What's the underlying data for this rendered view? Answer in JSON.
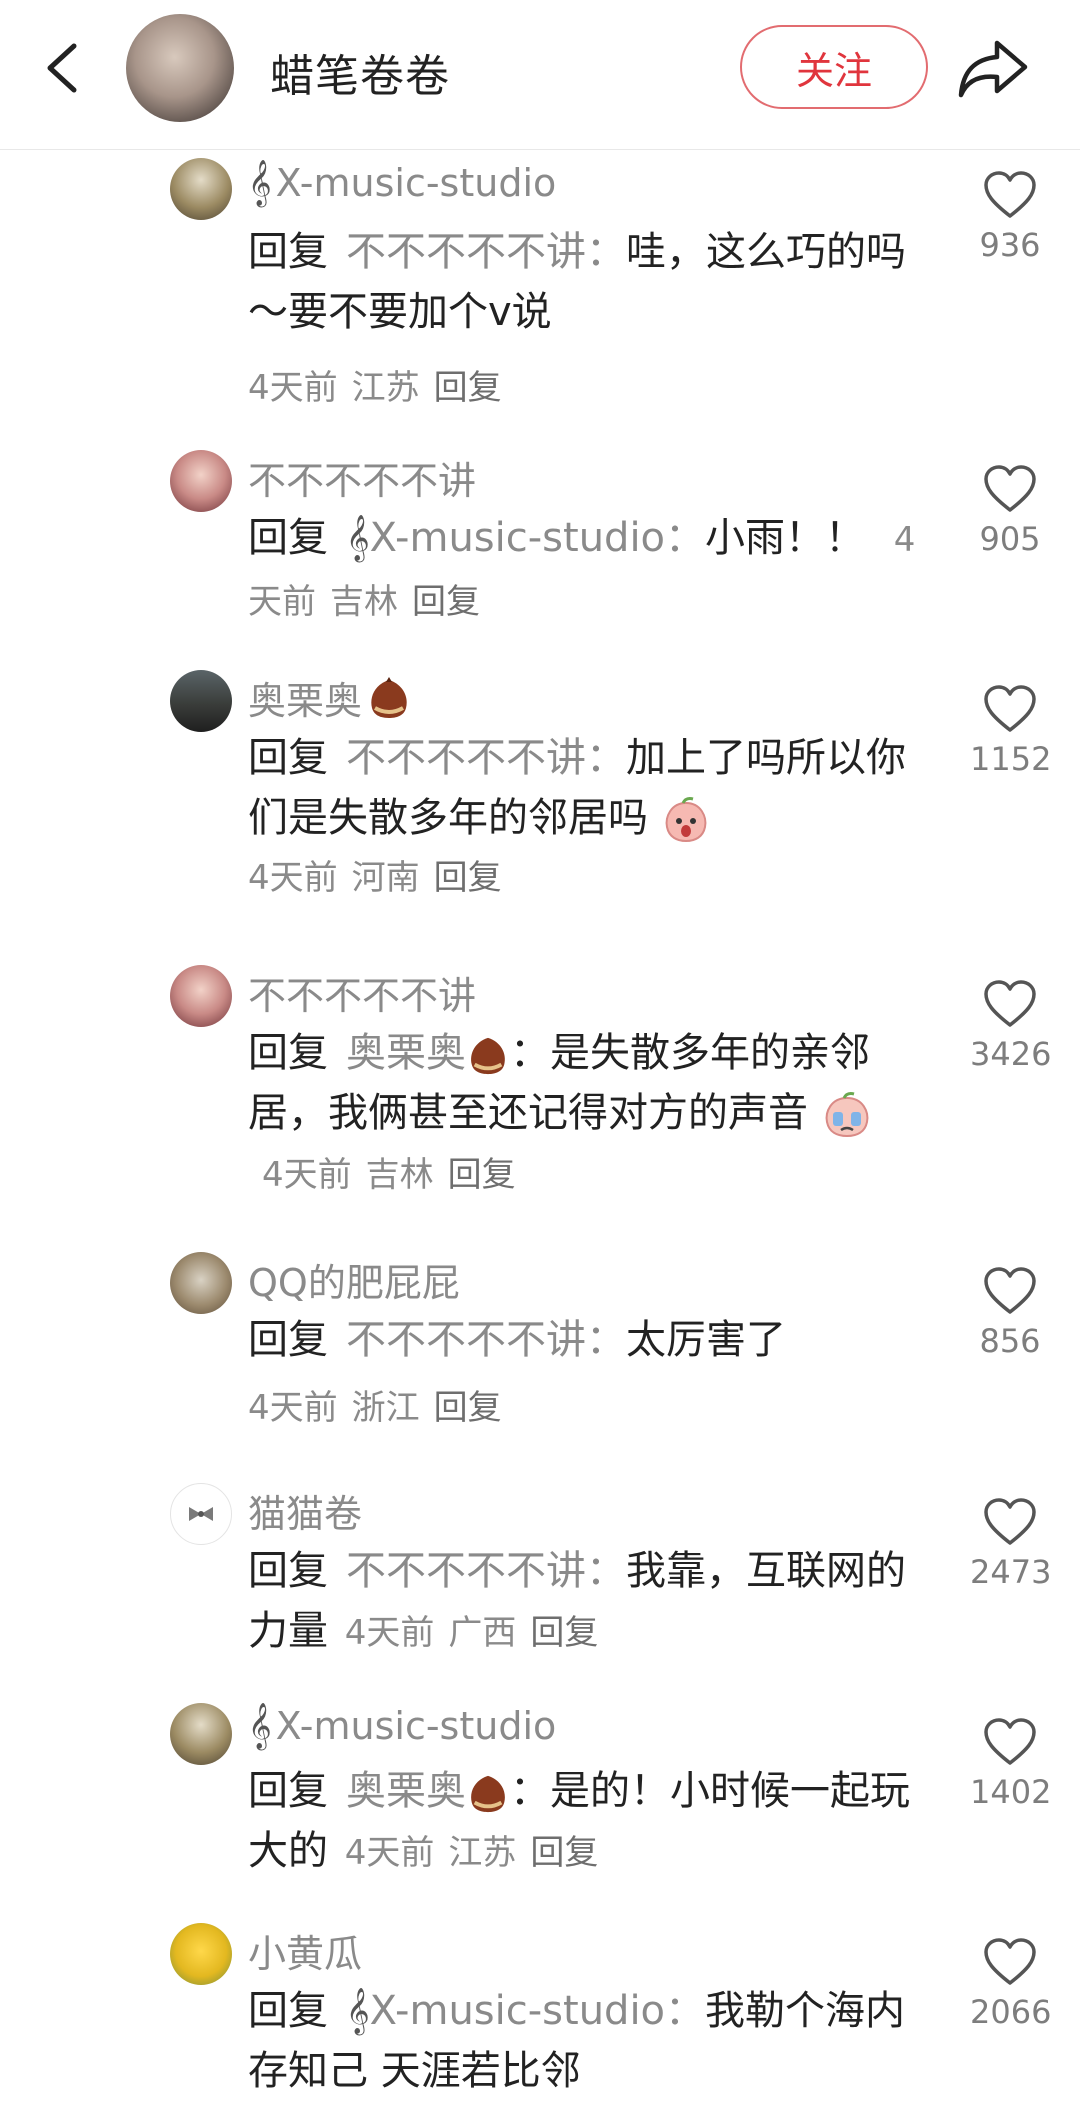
{
  "header": {
    "title": "蜡笔卷卷",
    "follow_label": "关注"
  },
  "comments": [
    {
      "author": "X-music-studio",
      "author_prefix_icon": "treble-clef-icon",
      "reply_word": "回复",
      "mention": "不不不不不讲：",
      "text": "哇，这么巧的吗～要不要加个v说",
      "time": "4天前",
      "location": "江苏",
      "reply_label": "回复",
      "likes": "936"
    },
    {
      "author": "不不不不不讲",
      "reply_word": "回复",
      "mention": "X-music-studio：",
      "text": "小雨！！",
      "time": "4天前",
      "location": "吉林",
      "reply_label": "回复",
      "likes": "905"
    },
    {
      "author": "奥栗奥",
      "author_suffix_icon": "chestnut-icon",
      "reply_word": "回复",
      "mention": "不不不不不讲：",
      "text": "加上了吗所以你们是失散多年的邻居吗",
      "text_suffix_icon": "shocked-peach-emoji",
      "time": "4天前",
      "location": "河南",
      "reply_label": "回复",
      "likes": "1152"
    },
    {
      "author": "不不不不不讲",
      "reply_word": "回复",
      "mention": "奥栗奥",
      "text": "：是失散多年的亲邻居，我俩甚至还记得对方的声音",
      "text_suffix_icon": "crying-peach-emoji",
      "time": "4天前",
      "location": "吉林",
      "reply_label": "回复",
      "likes": "3426"
    },
    {
      "author": "QQ的肥屁屁",
      "reply_word": "回复",
      "mention": "不不不不不讲：",
      "text": "太厉害了",
      "time": "4天前",
      "location": "浙江",
      "reply_label": "回复",
      "likes": "856"
    },
    {
      "author": "猫猫卷",
      "reply_word": "回复",
      "mention": "不不不不不讲：",
      "text": "我靠，互联网的力量",
      "time": "4天前",
      "location": "广西",
      "reply_label": "回复",
      "likes": "2473"
    },
    {
      "author": "X-music-studio",
      "author_prefix_icon": "treble-clef-icon",
      "reply_word": "回复",
      "mention": "奥栗奥",
      "text": "：是的！小时候一起玩大的",
      "time": "4天前",
      "location": "江苏",
      "reply_label": "回复",
      "likes": "1402"
    },
    {
      "author": "小黄瓜",
      "reply_word": "回复",
      "mention": "X-music-studio：",
      "text": "我勒个海内存知己 天涯若比邻",
      "likes": "2066"
    }
  ],
  "colors": {
    "accent": "#e0353d",
    "muted": "#8a8a8a",
    "text": "#222222"
  }
}
